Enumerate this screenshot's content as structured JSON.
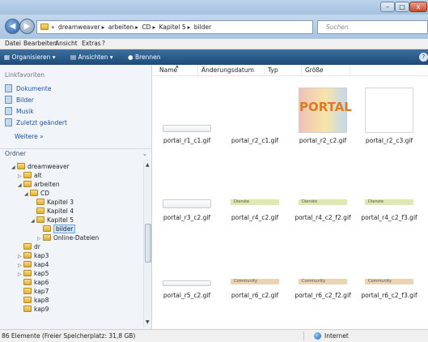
{
  "window": {
    "min": "–",
    "max": "□",
    "close": "x"
  },
  "address": {
    "prefix": "«",
    "crumbs": [
      "dreamweaver",
      "arbeiten",
      "CD",
      "Kapitel 5",
      "bilder"
    ],
    "sep": "▸",
    "dropdown": "▾",
    "refresh": "↻",
    "search_placeholder": "Suchen"
  },
  "menubar": [
    "Datei",
    "Bearbeiten",
    "Ansicht",
    "Extras",
    "?"
  ],
  "toolbar": {
    "organize": "Organisieren ▾",
    "views": "Ansichten ▾",
    "burn": "Brennen",
    "help": "?"
  },
  "sidebar": {
    "favorites_heading": "Linkfavoriten",
    "favorites": [
      "Dokumente",
      "Bilder",
      "Musik",
      "Zuletzt geändert"
    ],
    "more": "Weitere »",
    "folders_heading": "Ordner",
    "folders_chevron": "⌄",
    "tree": [
      {
        "label": "dreamweaver",
        "tri": "◢"
      },
      {
        "label": "alt",
        "tri": "▷"
      },
      {
        "label": "arbeiten",
        "tri": "◢"
      },
      {
        "label": "CD",
        "tri": "◢"
      },
      {
        "label": "Kapitel 3",
        "tri": ""
      },
      {
        "label": "Kapitel 4",
        "tri": ""
      },
      {
        "label": "Kapitel 5",
        "tri": "◢"
      },
      {
        "label": "bilder",
        "tri": ""
      },
      {
        "label": "Online-Dateien",
        "tri": "▷"
      },
      {
        "label": "dr",
        "tri": ""
      },
      {
        "label": "kap3",
        "tri": "▷"
      },
      {
        "label": "kap4",
        "tri": "▷"
      },
      {
        "label": "kap5",
        "tri": "▷"
      },
      {
        "label": "kap6",
        "tri": ""
      },
      {
        "label": "kap7",
        "tri": ""
      },
      {
        "label": "kap8",
        "tri": ""
      },
      {
        "label": "kap9",
        "tri": ""
      }
    ]
  },
  "columns": [
    "Name",
    "Änderungsdatum",
    "Typ",
    "Größe"
  ],
  "sort_indicator": "▲",
  "files": [
    {
      "name": "portal_r1_c1.gif"
    },
    {
      "name": "portal_r2_c1.gif"
    },
    {
      "name": "portal_r2_c2.gif",
      "image_text": "PORTAL"
    },
    {
      "name": "portal_r2_c3.gif"
    },
    {
      "name": "portal_r3_c2.gif"
    },
    {
      "name": "portal_r4_c2.gif",
      "tag": "Dienste"
    },
    {
      "name": "portal_r4_c2_f2.gif",
      "tag": "Dienste"
    },
    {
      "name": "portal_r4_c2_f3.gif",
      "tag": "Dienste"
    },
    {
      "name": "portal_r5_c2.gif"
    },
    {
      "name": "portal_r6_c2.gif",
      "tag": "Community"
    },
    {
      "name": "portal_r6_c2_f2.gif",
      "tag": "Community"
    },
    {
      "name": "portal_r6_c2_f3.gif",
      "tag": "Community"
    }
  ],
  "status": {
    "count": "86 Elemente (Freier Speicherplatz: 31,8 GB)",
    "zone": "Internet"
  },
  "colors": {
    "toolbar": "#1d4a78",
    "link": "#1f4f96",
    "portal_text": "#e07a1f",
    "dienste": "#dfe8b0",
    "community": "#ead4b4"
  }
}
